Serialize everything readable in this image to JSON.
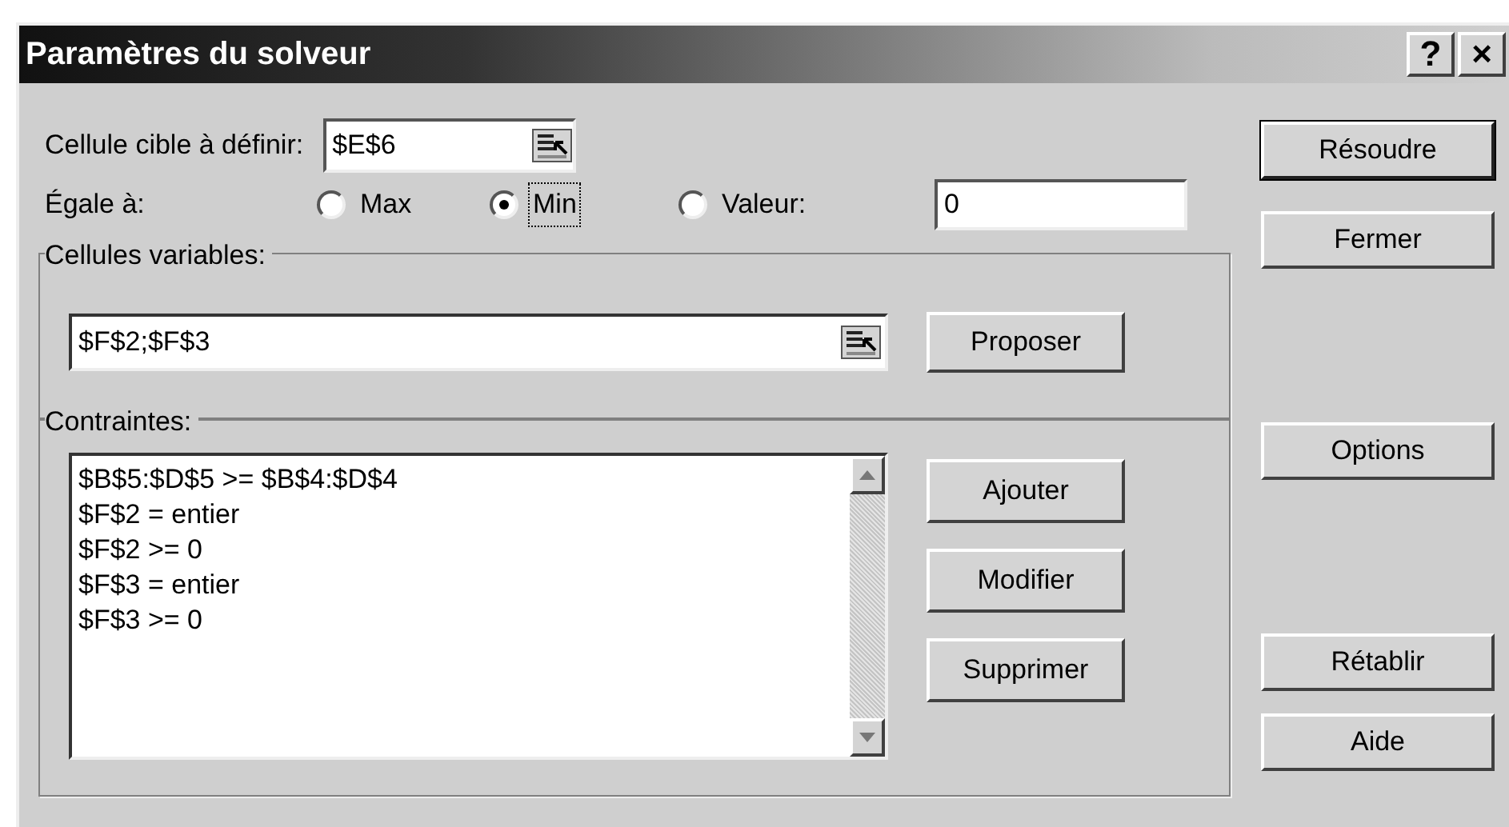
{
  "window": {
    "title": "Paramètres du solveur",
    "controls": [
      "?",
      "×"
    ]
  },
  "target_cell": {
    "label": "Cellule cible à définir:",
    "value": "$E$6"
  },
  "equal_to": {
    "label": "Égale à:",
    "options": [
      {
        "label": "Max",
        "selected": false
      },
      {
        "label": "Min",
        "selected": true
      },
      {
        "label": "Valeur:",
        "selected": false
      }
    ],
    "value": "0"
  },
  "variable_cells": {
    "title": "Cellules variables:",
    "value": "$F$2;$F$3",
    "button": "Proposer"
  },
  "constraints": {
    "title": "Contraintes:",
    "items": [
      "$B$5:$D$5 >= $B$4:$D$4",
      "$F$2 = entier",
      "$F$2 >= 0",
      "$F$3 = entier",
      "$F$3 >= 0"
    ],
    "buttons": [
      "Ajouter",
      "Modifier",
      "Supprimer"
    ]
  },
  "side_buttons": [
    {
      "label": "Résoudre",
      "kind": "default"
    },
    {
      "label": "Fermer",
      "kind": "normal"
    },
    {
      "label": "Options",
      "kind": "normal"
    },
    {
      "label": "Rétablir",
      "kind": "normal"
    },
    {
      "label": "Aide",
      "kind": "normal"
    }
  ]
}
